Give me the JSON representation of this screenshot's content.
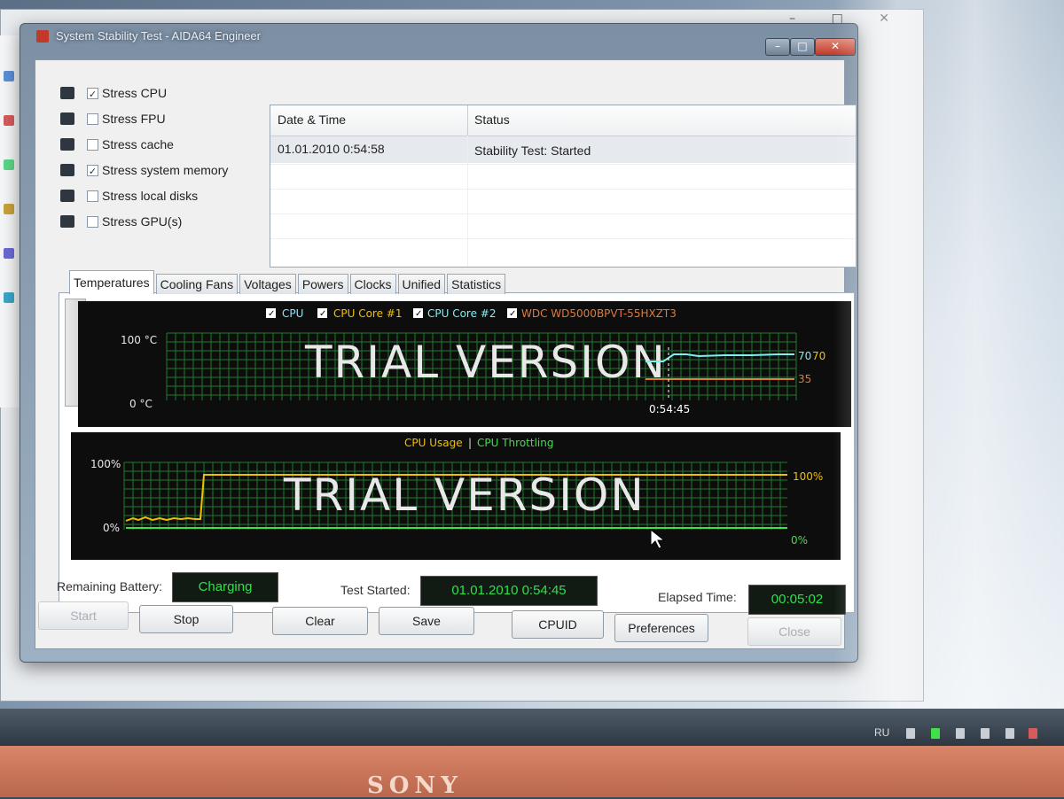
{
  "window": {
    "title": "System Stability Test - AIDA64 Engineer"
  },
  "stress_options": [
    {
      "label": "Stress CPU",
      "checked": true,
      "check_mark": "✓",
      "icon": "cpu-icon"
    },
    {
      "label": "Stress FPU",
      "checked": false,
      "check_mark": "",
      "icon": "fpu-icon"
    },
    {
      "label": "Stress cache",
      "checked": false,
      "check_mark": "",
      "icon": "cache-icon"
    },
    {
      "label": "Stress system memory",
      "checked": true,
      "check_mark": "✓",
      "icon": "memory-icon"
    },
    {
      "label": "Stress local disks",
      "checked": false,
      "check_mark": "",
      "icon": "disk-icon"
    },
    {
      "label": "Stress GPU(s)",
      "checked": false,
      "check_mark": "",
      "icon": "gpu-icon"
    }
  ],
  "log": {
    "columns": [
      "Date & Time",
      "Status"
    ],
    "rows": [
      {
        "datetime": "01.01.2010 0:54:58",
        "status": "Stability Test: Started"
      }
    ]
  },
  "tabs": [
    "Temperatures",
    "Cooling Fans",
    "Voltages",
    "Powers",
    "Clocks",
    "Unified",
    "Statistics"
  ],
  "active_tab": "Temperatures",
  "temperature_graph": {
    "legend": [
      {
        "label": "CPU",
        "color": "#8fe3ff",
        "checked": true
      },
      {
        "label": "CPU Core #1",
        "color": "#f0c000",
        "checked": true
      },
      {
        "label": "CPU Core #2",
        "color": "#7ff0f0",
        "checked": true
      },
      {
        "label": "WDC WD5000BPVT-55HXZT3",
        "color": "#e07a3a",
        "checked": true
      }
    ],
    "y_max_label": "100 °C",
    "y_min_label": "0 °C",
    "watermark": "TRIAL VERSION",
    "time_label": "0:54:45",
    "value_labels": [
      "70",
      "70",
      "35"
    ]
  },
  "usage_graph": {
    "legend": [
      {
        "label": "CPU Usage",
        "color": "#f0c000"
      },
      {
        "label": "CPU Throttling",
        "color": "#3fe04a"
      }
    ],
    "legend_separator": "|",
    "y_max_label": "100%",
    "y_min_label": "0%",
    "right_max_label": "100%",
    "right_min_label": "0%",
    "watermark": "TRIAL VERSION"
  },
  "status": {
    "battery_label": "Remaining Battery:",
    "battery_value": "Charging",
    "test_started_label": "Test Started:",
    "test_started_value": "01.01.2010 0:54:45",
    "elapsed_label": "Elapsed Time:",
    "elapsed_value": "00:05:02"
  },
  "buttons": {
    "start": "Start",
    "stop": "Stop",
    "clear": "Clear",
    "save": "Save",
    "cpuid": "CPUID",
    "preferences": "Preferences",
    "close": "Close"
  },
  "taskbar": {
    "language": "RU"
  },
  "brand": "SONY",
  "window_controls": {
    "minimize": "–",
    "maximize": "□",
    "close": "✕"
  },
  "colors": {
    "grid": "#1f7a2a",
    "status_text": "#2fe04a"
  }
}
